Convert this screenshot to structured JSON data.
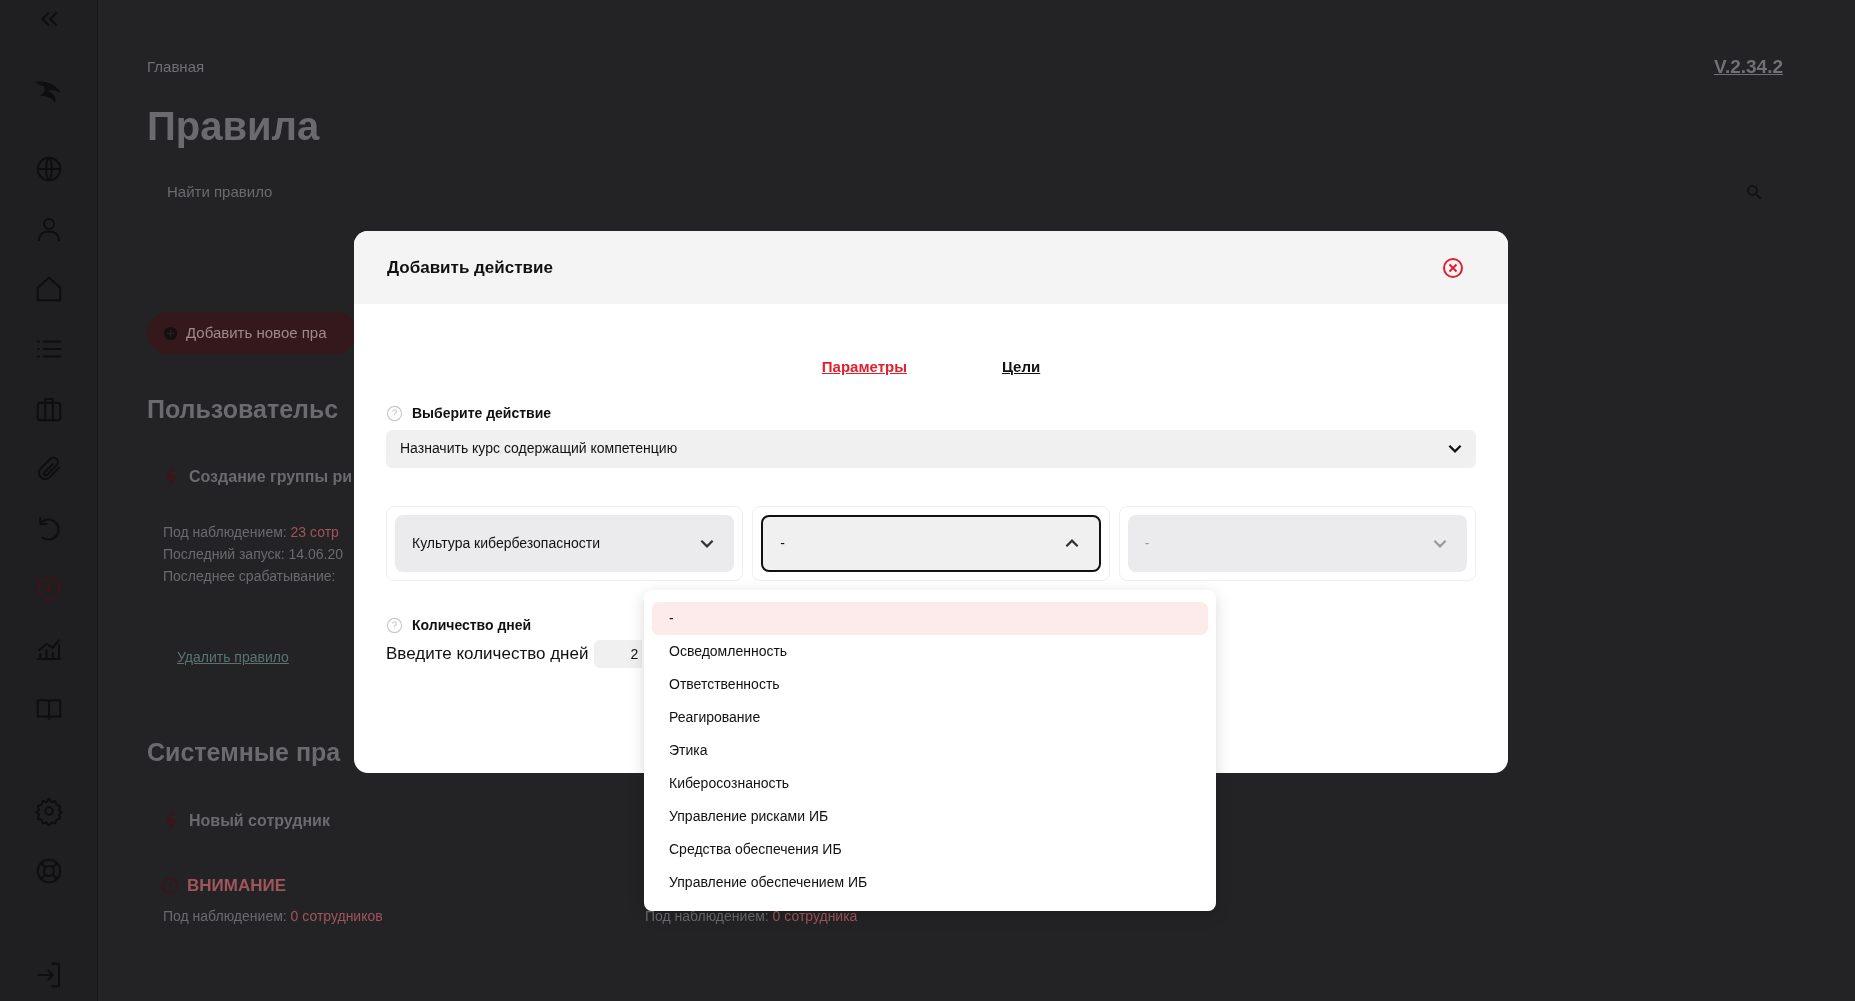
{
  "sidebar": {
    "items": [
      {
        "selected": false
      },
      {
        "selected": false
      },
      {
        "selected": false
      },
      {
        "selected": false
      },
      {
        "selected": false
      },
      {
        "selected": false
      },
      {
        "selected": false
      },
      {
        "selected": true
      },
      {
        "selected": false
      },
      {
        "selected": false
      },
      {
        "selected": false
      },
      {
        "selected": false
      }
    ]
  },
  "breadcrumb": "Главная",
  "version": "V.2.34.2",
  "page_title": "Правила",
  "search": {
    "placeholder": "Найти правило"
  },
  "add_button": "Добавить новое пра",
  "sections": [
    {
      "title": "Пользовательс",
      "rules": [
        {
          "title": "Создание группы ри",
          "lines": [
            {
              "label": "Под наблюдением:",
              "value": "23 сотр"
            },
            {
              "label": "Последний запуск: 14.06.20"
            },
            {
              "label": "Последнее срабатывание:"
            }
          ],
          "link": "Удалить правило"
        }
      ]
    },
    {
      "title": "Системные пра",
      "rules": [
        {
          "title": "Новый сотрудник",
          "warning": "ВНИМАНИЕ",
          "lines": [
            {
              "label": "Под наблюдением:",
              "value": "0 сотрудников"
            }
          ]
        },
        {
          "lines": [
            {
              "label": "Под наблюдением:",
              "value": "0 сотрудника"
            }
          ]
        }
      ]
    }
  ],
  "dialog": {
    "title": "Добавить действие",
    "tabs": [
      {
        "label": "Параметры",
        "selected": true
      },
      {
        "label": "Цели",
        "selected": false
      }
    ],
    "action": {
      "label": "Выберите действие",
      "value": "Назначить курс содержащий компетенцию"
    },
    "selects": [
      {
        "value": "Культура кибербезопасности",
        "open": false,
        "disabled": false
      },
      {
        "value": "-",
        "open": true,
        "disabled": false
      },
      {
        "value": "-",
        "open": false,
        "disabled": true
      }
    ],
    "days": {
      "label": "Количество дней",
      "prompt": "Введите количество дней",
      "value": "2"
    },
    "dropdown": {
      "options": [
        {
          "label": "-",
          "selected": true
        },
        {
          "label": "Осведомленность",
          "selected": false
        },
        {
          "label": "Ответственность",
          "selected": false
        },
        {
          "label": "Реагирование",
          "selected": false
        },
        {
          "label": "Этика",
          "selected": false
        },
        {
          "label": "Киберосознаность",
          "selected": false
        },
        {
          "label": "Управление рисками ИБ",
          "selected": false
        },
        {
          "label": "Средства обеспечения ИБ",
          "selected": false
        },
        {
          "label": "Управление обеспечением ИБ",
          "selected": false
        }
      ]
    }
  }
}
